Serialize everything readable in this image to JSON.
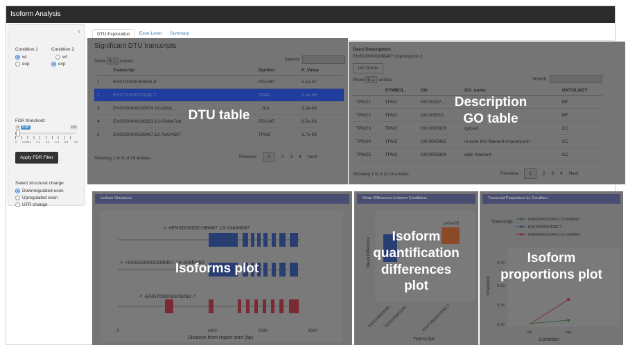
{
  "app": {
    "title": "Isoform Analysis"
  },
  "sidebar": {
    "collapse_icon": "chevron-left-icon",
    "condition1": {
      "label": "Condition 1",
      "options": [
        "wt",
        "exp"
      ],
      "selected": "wt"
    },
    "condition2": {
      "label": "Condition 2",
      "options": [
        "wt",
        "exp"
      ],
      "selected": "exp"
    },
    "fdr": {
      "label": "FDR threshold:",
      "min_label": "0",
      "value_label": "0.05",
      "max_label": "0.5",
      "value": 0.05,
      "ticks": [
        "0",
        "0.0001",
        "0.1",
        "0.2",
        "0.3",
        "0.4",
        "0.5"
      ]
    },
    "apply_button": "Apply FDR Filter",
    "structural": {
      "label": "Select structural change:",
      "options": [
        "Downregulated exon",
        "Upregulated exon",
        "UTR change"
      ],
      "selected": "Downregulated exon"
    }
  },
  "tabs": [
    {
      "label": "DTU Exploration",
      "active": true
    },
    {
      "label": "Exon-Level",
      "active": false
    },
    {
      "label": "Summary",
      "active": false
    }
  ],
  "dtu": {
    "title": "Significant DTU transcripts",
    "show_label": "Show",
    "entries_value": "5",
    "entries_label": "entries",
    "search_label": "Search:",
    "columns": [
      "",
      "Transcript",
      "Symbol",
      "P_Value"
    ],
    "rows": [
      [
        "1",
        "ENST00000355841.6",
        "PDLIM7",
        "3.1e-07"
      ],
      [
        "2",
        "ENST00000378292.7",
        "TPM2",
        "3.2e-06"
      ],
      [
        "3",
        "ENSG00000138674.16-d1fd1...",
        "...SIA",
        "3.3e-06"
      ],
      [
        "4",
        "ENSG00000196923.13-00a9e7dd",
        "PDLIM7",
        "8.5e-06"
      ],
      [
        "5",
        "ENSG00000198467.13-7a434697",
        "TPM2",
        "1.7e-05"
      ]
    ],
    "selected_row": 1,
    "info": "Showing 1 to 5 of 19 entries",
    "pagination": {
      "previous": "Previous",
      "pages": [
        "1",
        "2",
        "3",
        "4"
      ],
      "next": "Next",
      "current": "1"
    },
    "overlay": "DTU table"
  },
  "go": {
    "gene_desc_label": "Gene Description:",
    "gene_desc": "ENSG00000198467 tropomyosin 2",
    "button": "GO Terms",
    "show_label": "Show",
    "entries_value": "5",
    "entries_label": "entries",
    "search_label": "Search:",
    "columns": [
      "",
      "SYMBOL",
      "GO",
      "GO_name",
      "ONTOLOGY"
    ],
    "rows": [
      [
        "TPM21",
        "TPM2",
        "GO:00037...",
        "",
        "MF"
      ],
      [
        "TPM22",
        "TPM2",
        "GO:005515",
        "",
        "MF"
      ],
      [
        "TPM23",
        "TPM2",
        "GO:0005829",
        "cytosol",
        "CC"
      ],
      [
        "TPM24",
        "TPM2",
        "GO:0005862",
        "muscle thin filament tropomyosin",
        "CC"
      ],
      [
        "TPM25",
        "TPM2",
        "GO:0005884",
        "actin filament",
        "CC"
      ]
    ],
    "info": "Showing 1 to 5 of 16 entries",
    "pagination": {
      "previous": "Previous",
      "pages": [
        "1",
        "2",
        "3",
        "4"
      ],
      "next": "Next",
      "current": "1"
    },
    "overlay_line1": "Description",
    "overlay_line2": "GO table"
  },
  "isoforms": {
    "header": "Isoform Structures",
    "labels": [
      "< +ENSG00000198467.13-7a434697",
      "< +ENSG00000198467.13-309f0cb0",
      "< -ENST00000378292.7"
    ],
    "x_ticks": [
      "0",
      "1000",
      "2000",
      "3000"
    ],
    "xlabel": "Distance from region start (bp)",
    "colors": {
      "blue": "#283e72",
      "red": "#7a2a33"
    },
    "overlay": "Isoforms plot"
  },
  "quant": {
    "header": "Mean Differences between Conditions",
    "ylabel": "Mean Difference",
    "pvalue": "p=1e-05",
    "categories": [
      "ENSG00000198...",
      "ENSG00000198...",
      "ENST00000378292.7"
    ],
    "xlabel": "Transcript",
    "colors": {
      "bar1": "#283e72",
      "bar2": "#8a4a28"
    },
    "overlay_lines": [
      "Isoform",
      "quantification",
      "differences",
      "plot"
    ]
  },
  "props": {
    "header": "Transcript Proportions by Condition",
    "legend_title": "Transcript",
    "legend": [
      "ENSG00000198467.13-309f0cb0",
      "ENST00000378292.7",
      "ENSG00000198467.13-7a434697"
    ],
    "y_ticks": [
      "0.75",
      "0.50",
      "0.25",
      "0.00"
    ],
    "ylabel": "Proportion",
    "x_ticks": [
      "ctrl",
      "exp"
    ],
    "xlabel": "Condition",
    "colors": {
      "s1": "#3a5a3a",
      "s2": "#2a4a6e",
      "s3": "#7a2a33"
    },
    "overlay_lines": [
      "Isoform",
      "proportions plot"
    ]
  }
}
